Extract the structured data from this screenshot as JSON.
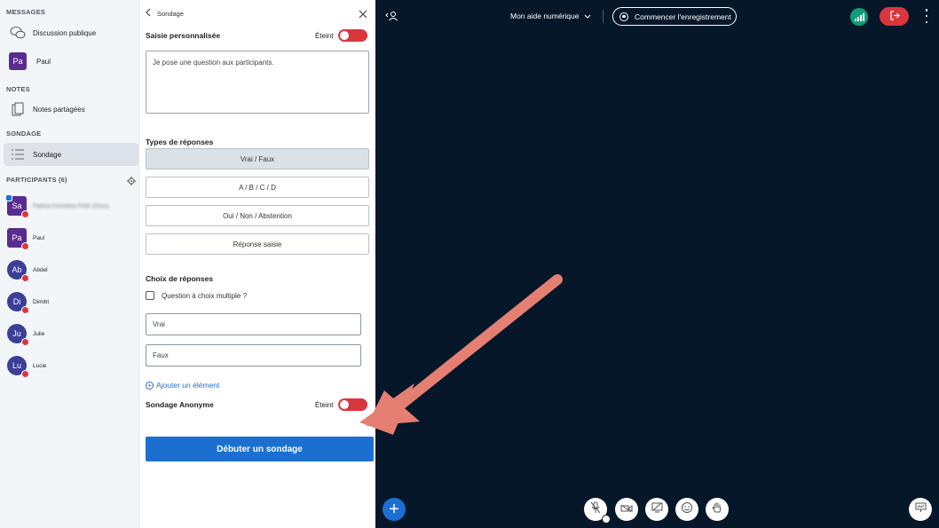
{
  "sidebar": {
    "messages_header": "MESSAGES",
    "public_chat": "Discussion publique",
    "private_chat": {
      "initials": "Pa",
      "name": "Paul"
    },
    "notes_header": "NOTES",
    "shared_notes": "Notes partagées",
    "poll_header": "SONDAGE",
    "poll_item": "Sondage",
    "participants_header": "PARTICIPANTS (6)",
    "participants": [
      {
        "initials": "Sa",
        "name": "Fatima Cornelius FAIK (Vous)",
        "shape": "square",
        "presenter": true,
        "blurred": true
      },
      {
        "initials": "Pa",
        "name": "Paul",
        "shape": "square",
        "presenter": false,
        "blurred": false
      },
      {
        "initials": "Ab",
        "name": "Abdel",
        "shape": "circle",
        "presenter": false,
        "blurred": false
      },
      {
        "initials": "Di",
        "name": "Dimitri",
        "shape": "circle",
        "presenter": false,
        "blurred": false
      },
      {
        "initials": "Ju",
        "name": "Julie",
        "shape": "circle",
        "presenter": false,
        "blurred": false
      },
      {
        "initials": "Lu",
        "name": "Lucie",
        "shape": "circle",
        "presenter": false,
        "blurred": false
      }
    ]
  },
  "panel": {
    "back_label": "Sondage",
    "custom_input_label": "Saisie personnalisée",
    "custom_input_state": "Éteint",
    "question_text": "Je pose une question aux participants.",
    "response_types_label": "Types de réponses",
    "response_types": [
      {
        "label": "Vrai / Faux",
        "selected": true
      },
      {
        "label": "A / B / C / D",
        "selected": false
      },
      {
        "label": "Oui / Non / Abstention",
        "selected": false
      },
      {
        "label": "Réponse saisie",
        "selected": false
      }
    ],
    "choices_label": "Choix de réponses",
    "multiple_choice_label": "Question à choix multiple ?",
    "options": [
      "Vrai",
      "Faux"
    ],
    "add_item_label": "Ajouter un élément",
    "anonymous_label": "Sondage Anonyme",
    "anonymous_state": "Éteint",
    "start_button": "Débuter un sondage"
  },
  "main": {
    "title": "Mon aide numérique",
    "record_button": "Commencer l'enregistrement"
  },
  "colors": {
    "accent": "#1b6fd1",
    "danger": "#d9363e",
    "background": "#06172a",
    "connection": "#0f9d77",
    "arrow": "#e57f72"
  }
}
